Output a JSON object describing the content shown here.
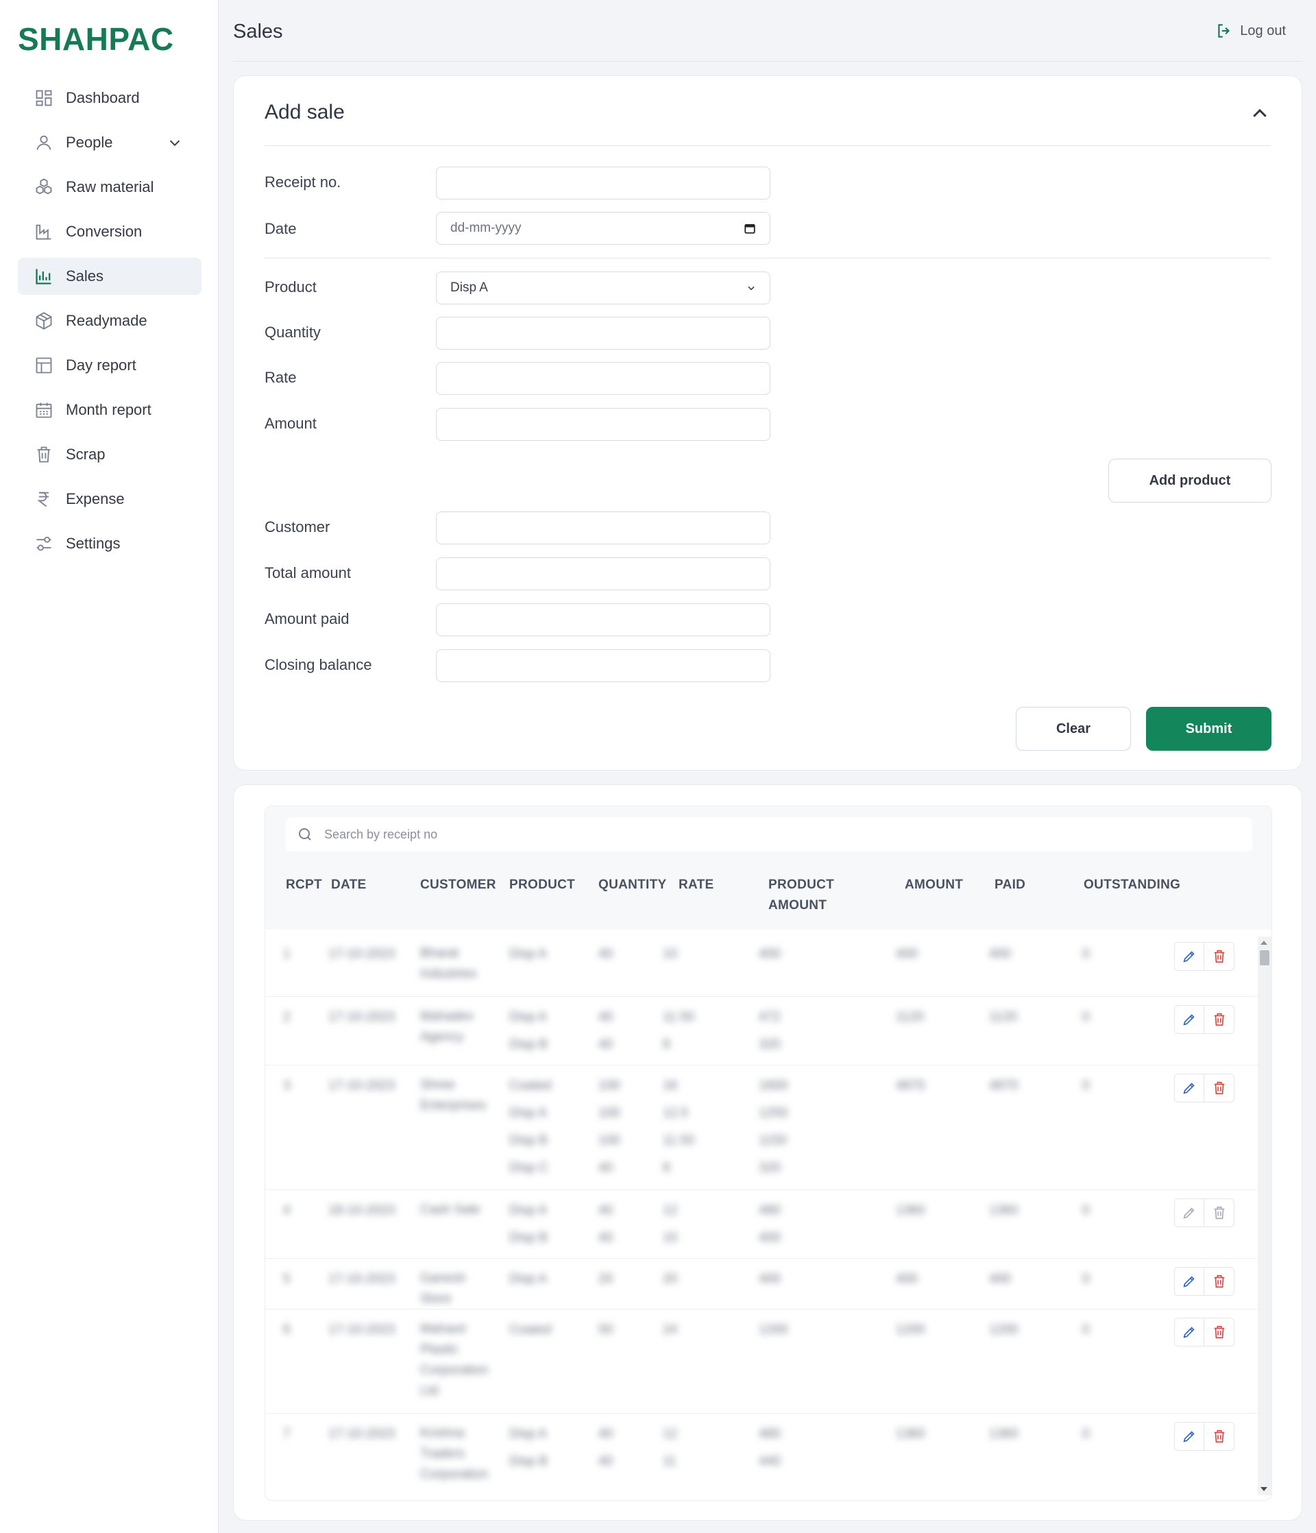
{
  "brand": "SHAHPAC",
  "sidebar": {
    "items": [
      {
        "label": "Dashboard",
        "icon": "dashboard-icon"
      },
      {
        "label": "People",
        "icon": "user-icon",
        "expandable": true
      },
      {
        "label": "Raw material",
        "icon": "boxes-icon"
      },
      {
        "label": "Conversion",
        "icon": "factory-icon"
      },
      {
        "label": "Sales",
        "icon": "bar-chart-icon",
        "active": true
      },
      {
        "label": "Readymade",
        "icon": "package-icon"
      },
      {
        "label": "Day report",
        "icon": "table-icon"
      },
      {
        "label": "Month report",
        "icon": "calendar-icon"
      },
      {
        "label": "Scrap",
        "icon": "trash-icon"
      },
      {
        "label": "Expense",
        "icon": "rupee-icon"
      },
      {
        "label": "Settings",
        "icon": "sliders-icon"
      }
    ]
  },
  "header": {
    "title": "Sales",
    "logout_label": "Log out"
  },
  "form": {
    "title": "Add sale",
    "fields": {
      "receipt_no": {
        "label": "Receipt no.",
        "value": ""
      },
      "date": {
        "label": "Date",
        "placeholder": "dd-mm-yyyy"
      },
      "product": {
        "label": "Product",
        "value": "Disp A"
      },
      "quantity": {
        "label": "Quantity",
        "value": ""
      },
      "rate": {
        "label": "Rate",
        "value": ""
      },
      "amount": {
        "label": "Amount",
        "value": ""
      },
      "customer": {
        "label": "Customer",
        "value": ""
      },
      "total_amount": {
        "label": "Total amount",
        "value": ""
      },
      "amount_paid": {
        "label": "Amount paid",
        "value": ""
      },
      "closing_balance": {
        "label": "Closing balance",
        "value": ""
      }
    },
    "add_product_label": "Add product",
    "clear_label": "Clear",
    "submit_label": "Submit"
  },
  "table": {
    "search_placeholder": "Search by receipt no",
    "columns": [
      "RCPT",
      "DATE",
      "CUSTOMER",
      "PRODUCT",
      "QUANTITY",
      "RATE",
      "PRODUCT AMOUNT",
      "AMOUNT",
      "PAID",
      "OUTSTANDING"
    ],
    "rows": [
      {
        "rcpt": "1",
        "date": "17-10-2023",
        "customer": "Bharat Industries",
        "products": [
          "Disp A"
        ],
        "qty": [
          "40"
        ],
        "rate": [
          "10"
        ],
        "pamount": [
          "400"
        ],
        "amount": "400",
        "paid": "400",
        "outstanding": "0",
        "edit_enabled": true
      },
      {
        "rcpt": "2",
        "date": "17-10-2023",
        "customer": "Mahadev Agency",
        "products": [
          "Disp A",
          "Disp B"
        ],
        "qty": [
          "40",
          "40"
        ],
        "rate": [
          "11.50",
          "8"
        ],
        "pamount": [
          "472",
          "320"
        ],
        "amount": "1120",
        "paid": "1120",
        "outstanding": "0",
        "edit_enabled": true
      },
      {
        "rcpt": "3",
        "date": "17-10-2023",
        "customer": "Shree Enterprises",
        "products": [
          "Coated",
          "Disp A",
          "Disp B",
          "Disp C"
        ],
        "qty": [
          "100",
          "100",
          "100",
          "40"
        ],
        "rate": [
          "16",
          "12.5",
          "11.50",
          "8"
        ],
        "pamount": [
          "1600",
          "1250",
          "1150",
          "320"
        ],
        "amount": "4870",
        "paid": "4870",
        "outstanding": "0",
        "edit_enabled": true
      },
      {
        "rcpt": "4",
        "date": "18-10-2023",
        "customer": "Cash Sale",
        "products": [
          "Disp A",
          "Disp B"
        ],
        "qty": [
          "40",
          "40"
        ],
        "rate": [
          "12",
          "10"
        ],
        "pamount": [
          "480",
          "400"
        ],
        "amount": "1360",
        "paid": "1360",
        "outstanding": "0",
        "edit_enabled": false
      },
      {
        "rcpt": "5",
        "date": "17-10-2023",
        "customer": "Ganesh Store",
        "products": [
          "Disp A"
        ],
        "qty": [
          "20"
        ],
        "rate": [
          "20"
        ],
        "pamount": [
          "400"
        ],
        "amount": "400",
        "paid": "400",
        "outstanding": "0",
        "edit_enabled": true
      },
      {
        "rcpt": "6",
        "date": "17-10-2023",
        "customer": "Mahavir Plastic Corporation Ltd",
        "products": [
          "Coated"
        ],
        "qty": [
          "50"
        ],
        "rate": [
          "24"
        ],
        "pamount": [
          "1200"
        ],
        "amount": "1200",
        "paid": "1200",
        "outstanding": "0",
        "edit_enabled": true
      },
      {
        "rcpt": "7",
        "date": "17-10-2023",
        "customer": "Krishna Traders Corporation",
        "products": [
          "Disp A",
          "Disp B"
        ],
        "qty": [
          "40",
          "40"
        ],
        "rate": [
          "12",
          "11"
        ],
        "pamount": [
          "480",
          "440"
        ],
        "amount": "1360",
        "paid": "1360",
        "outstanding": "0",
        "edit_enabled": true
      }
    ]
  }
}
